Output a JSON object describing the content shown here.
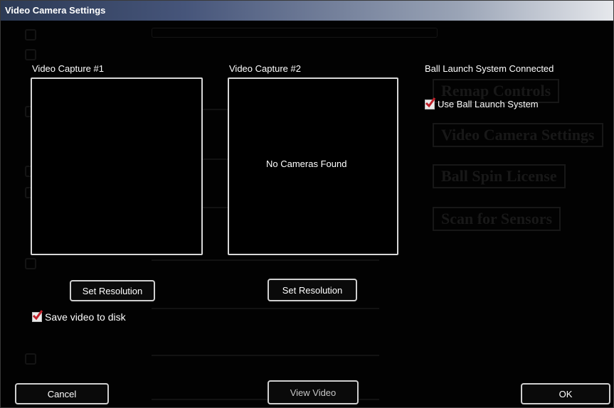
{
  "window": {
    "title": "Video Camera Settings"
  },
  "capture1": {
    "label": "Video Capture #1",
    "set_resolution": "Set Resolution"
  },
  "capture2": {
    "label": "Video Capture #2",
    "no_cameras": "No Cameras Found",
    "set_resolution": "Set Resolution"
  },
  "save_video": {
    "label": "Save video to disk",
    "checked": true
  },
  "ball_launch": {
    "status": "Ball Launch System Connected",
    "use_label": "Use Ball Launch System",
    "checked": true
  },
  "buttons": {
    "cancel": "Cancel",
    "view_video": "View Video",
    "ok": "OK"
  },
  "background": {
    "remap": "Remap Controls",
    "camera_settings": "Video Camera Settings",
    "spin_license": "Ball Spin License",
    "scan": "Scan for Sensors"
  },
  "colors": {
    "checkmark": "#c0202a",
    "border": "#d8d8d8"
  }
}
